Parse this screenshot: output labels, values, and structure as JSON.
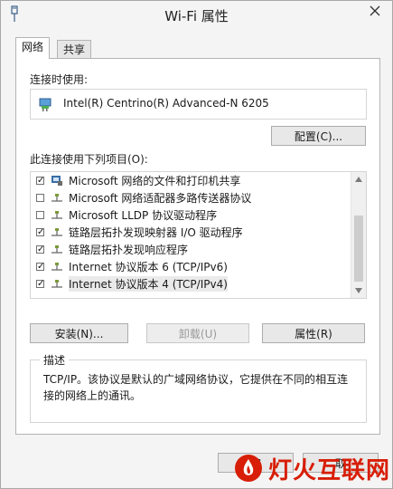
{
  "window": {
    "title": "Wi-Fi 属性",
    "close_icon": "close-icon"
  },
  "tabs": [
    {
      "label": "网络",
      "active": true
    },
    {
      "label": "共享",
      "active": false
    }
  ],
  "connect_using": {
    "label": "连接时使用:",
    "adapter_name": "Intel(R) Centrino(R) Advanced-N 6205",
    "config_button": "配置(C)..."
  },
  "items_section": {
    "label": "此连接使用下列项目(O):",
    "items": [
      {
        "label": "Microsoft 网络的文件和打印机共享",
        "checked": true,
        "icon": "printer-share-icon"
      },
      {
        "label": "Microsoft 网络适配器多路传送器协议",
        "checked": false,
        "icon": "protocol-icon"
      },
      {
        "label": "Microsoft LLDP 协议驱动程序",
        "checked": false,
        "icon": "protocol-icon"
      },
      {
        "label": "链路层拓扑发现映射器 I/O 驱动程序",
        "checked": true,
        "icon": "protocol-icon"
      },
      {
        "label": "链路层拓扑发现响应程序",
        "checked": true,
        "icon": "protocol-icon"
      },
      {
        "label": "Internet 协议版本 6 (TCP/IPv6)",
        "checked": true,
        "icon": "protocol-icon"
      },
      {
        "label": "Internet 协议版本 4 (TCP/IPv4)",
        "checked": true,
        "icon": "protocol-icon",
        "selected": true
      }
    ]
  },
  "actions": {
    "install": "安装(N)...",
    "uninstall": "卸载(U)",
    "properties": "属性(R)"
  },
  "description": {
    "title": "描述",
    "text": "TCP/IP。该协议是默认的广域网络协议，它提供在不同的相互连接的网络上的通讯。"
  },
  "footer": {
    "ok_partial": "確",
    "cancel_partial": "取"
  },
  "watermark": {
    "text": "灯火互联网",
    "color": "#d81e06"
  }
}
